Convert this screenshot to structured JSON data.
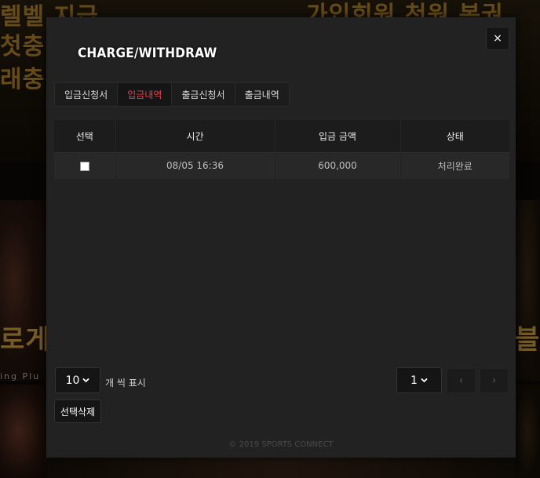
{
  "background": {
    "banner_left": "렐벨 지급",
    "banner_left_2": "첫충",
    "banner_left_3": "래충전",
    "banner_right": "가입회원 천원 복권",
    "side_left_text": "로게이",
    "side_left_sub": "ing Plu",
    "side_right_text": "블"
  },
  "modal": {
    "title": "CHARGE/WITHDRAW",
    "close_label": "×"
  },
  "tabs": [
    {
      "label": "입금신청서",
      "active": false
    },
    {
      "label": "입금내역",
      "active": true
    },
    {
      "label": "출금신청서",
      "active": false
    },
    {
      "label": "출금내역",
      "active": false
    }
  ],
  "table": {
    "headers": [
      "선택",
      "시간",
      "입금 금액",
      "상태"
    ],
    "rows": [
      {
        "time": "08/05 16:36",
        "amount": "600,000",
        "status": "처리완료"
      }
    ]
  },
  "pagination": {
    "page_size": "10",
    "page_size_label": "개 씩 표시",
    "current_page": "1",
    "prev_icon": "‹",
    "next_icon": "›"
  },
  "actions": {
    "delete_selected": "선택삭제"
  },
  "footer": {
    "copyright": "© 2019 SPORTS CONNECT"
  },
  "colors": {
    "active_tab": "#e0414b",
    "modal_bg": "#222222"
  }
}
